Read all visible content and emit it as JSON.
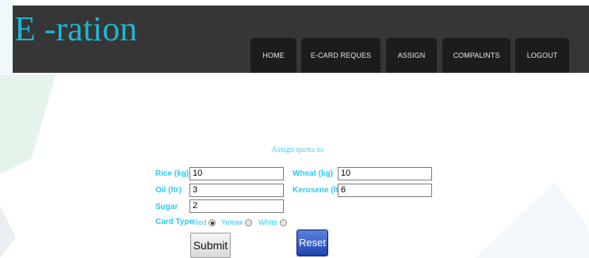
{
  "logo": "E -ration",
  "nav": [
    {
      "label": "HOME"
    },
    {
      "label": "E-CARD REQUES"
    },
    {
      "label": "ASSIGN"
    },
    {
      "label": "COMPALINTS"
    },
    {
      "label": "LOGOUT"
    }
  ],
  "form": {
    "title": "Assign quota to",
    "rice": {
      "label": "Rice (kg)",
      "value": "10"
    },
    "wheat": {
      "label": "Wheat (kg)",
      "value": "10"
    },
    "oil": {
      "label": "Oil (ltr)",
      "value": "3"
    },
    "kerosene": {
      "label": "Kerosene (ltr)",
      "value": "6"
    },
    "sugar": {
      "label": "Sugar",
      "value": "2"
    },
    "card_type": {
      "label": "Card Type",
      "options": [
        "Red",
        "Yellow",
        "White"
      ],
      "selected": "Red"
    },
    "submit_label": "Submit",
    "reset_label": "Reset"
  },
  "colors": {
    "header_bg": "#363636",
    "nav_bg": "#1c1c1c",
    "logo": "#1fb5d0",
    "label": "#2ec8ef",
    "reset_bg": "#2a50c0",
    "bg_shape_light": "#eef8fd",
    "bg_shape_green": "#e6f3ea"
  }
}
